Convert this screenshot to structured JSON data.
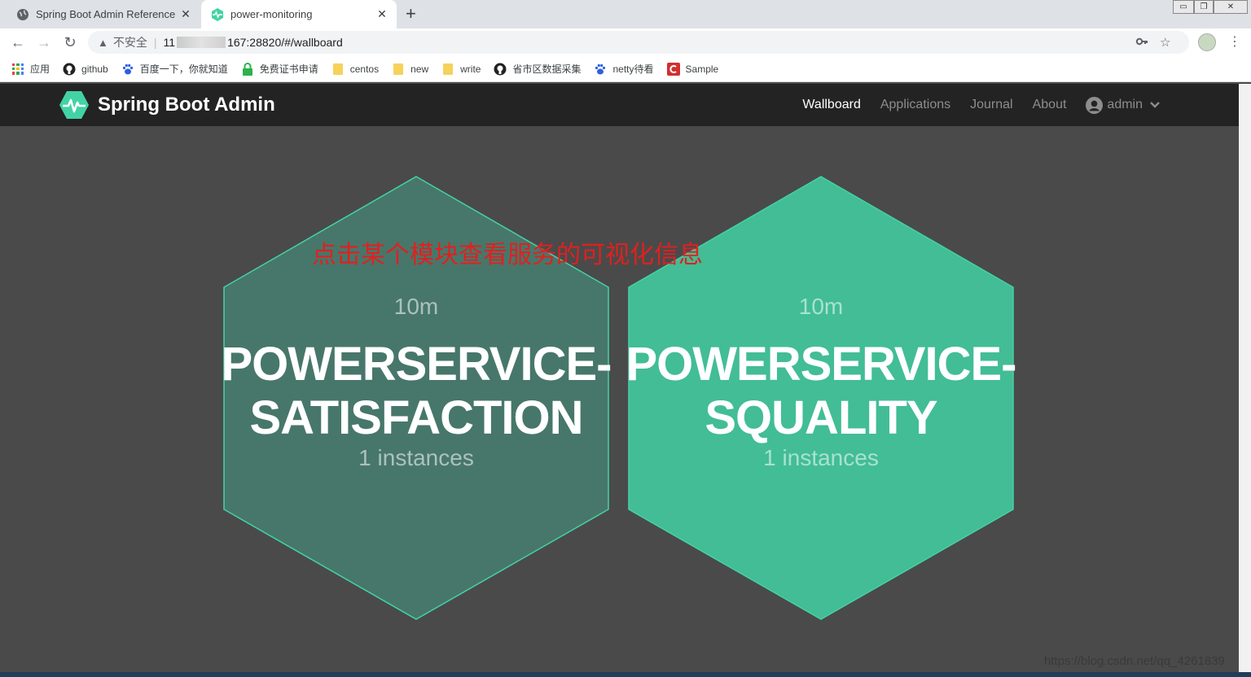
{
  "browser": {
    "tabs": [
      {
        "label": "Spring Boot Admin Reference",
        "icon": "globe-icon"
      },
      {
        "label": "power-monitoring",
        "icon": "spring-boot-admin-icon",
        "active": true
      }
    ],
    "window_controls": {
      "minimize": "▭",
      "restore": "❐",
      "close": "✕"
    },
    "address": {
      "security_label": "不安全",
      "url_prefix": "11",
      "url_suffix": "167:28820/#/wallboard"
    },
    "bookmarks": [
      {
        "label": "应用",
        "icon": "apps-grid-icon"
      },
      {
        "label": "github",
        "icon": "github-icon"
      },
      {
        "label": "百度一下，你就知道",
        "icon": "baidu-paw-icon"
      },
      {
        "label": "免费证书申请",
        "icon": "lock-icon"
      },
      {
        "label": "centos",
        "icon": "folder-icon"
      },
      {
        "label": "new",
        "icon": "folder-icon"
      },
      {
        "label": "write",
        "icon": "folder-icon"
      },
      {
        "label": "省市区数据采集",
        "icon": "github-icon"
      },
      {
        "label": "netty待看",
        "icon": "baidu-paw-icon"
      },
      {
        "label": "Sample",
        "icon": "c-logo-icon"
      }
    ]
  },
  "app": {
    "brand": "Spring Boot Admin",
    "nav": {
      "wallboard": "Wallboard",
      "applications": "Applications",
      "journal": "Journal",
      "about": "About",
      "user": "admin"
    }
  },
  "wallboard": {
    "annotation": "点击某个模块查看服务的可视化信息",
    "applications": [
      {
        "time": "10m",
        "name_line1": "POWERSERVICE-",
        "name_line2": "SATISFACTION",
        "instances": "1 instances",
        "fill_color": "#47776a",
        "stroke_color": "#42d3a5"
      },
      {
        "time": "10m",
        "name_line1": "POWERSERVICE-",
        "name_line2": "SQUALITY",
        "instances": "1 instances",
        "fill_color": "#42bd95",
        "stroke_color": "#42d3a5"
      }
    ]
  },
  "watermark": "https://blog.csdn.net/qq_4261839"
}
